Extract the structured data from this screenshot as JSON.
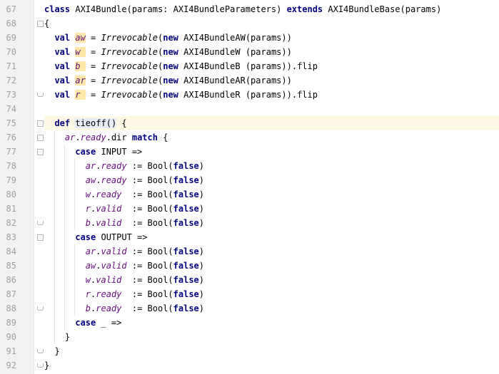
{
  "editor": {
    "lines": [
      {
        "num": "67",
        "tokens": [
          {
            "t": "class ",
            "c": "kw"
          },
          {
            "t": "AXI4Bundle(params: AXI4BundleParameters) "
          },
          {
            "t": "extends ",
            "c": "kw"
          },
          {
            "t": "AXI4BundleBase(params)"
          }
        ]
      },
      {
        "num": "68",
        "tokens": [
          {
            "t": "{"
          }
        ]
      },
      {
        "num": "69",
        "tokens": [
          {
            "t": "  "
          },
          {
            "t": "val ",
            "c": "kw"
          },
          {
            "t": "aw",
            "c": "field mark"
          },
          {
            "t": " = "
          },
          {
            "t": "Irrevocable",
            "c": "it"
          },
          {
            "t": "("
          },
          {
            "t": "new ",
            "c": "kw"
          },
          {
            "t": "AXI4BundleAW(params))"
          }
        ]
      },
      {
        "num": "70",
        "tokens": [
          {
            "t": "  "
          },
          {
            "t": "val ",
            "c": "kw"
          },
          {
            "t": "w ",
            "c": "field mark"
          },
          {
            "t": " = "
          },
          {
            "t": "Irrevocable",
            "c": "it"
          },
          {
            "t": "("
          },
          {
            "t": "new ",
            "c": "kw"
          },
          {
            "t": "AXI4BundleW (params))"
          }
        ]
      },
      {
        "num": "71",
        "tokens": [
          {
            "t": "  "
          },
          {
            "t": "val ",
            "c": "kw"
          },
          {
            "t": "b ",
            "c": "field mark"
          },
          {
            "t": " = "
          },
          {
            "t": "Irrevocable",
            "c": "it"
          },
          {
            "t": "("
          },
          {
            "t": "new ",
            "c": "kw"
          },
          {
            "t": "AXI4BundleB (params)).flip"
          }
        ]
      },
      {
        "num": "72",
        "tokens": [
          {
            "t": "  "
          },
          {
            "t": "val ",
            "c": "kw"
          },
          {
            "t": "ar",
            "c": "field mark"
          },
          {
            "t": " = "
          },
          {
            "t": "Irrevocable",
            "c": "it"
          },
          {
            "t": "("
          },
          {
            "t": "new ",
            "c": "kw"
          },
          {
            "t": "AXI4BundleAR(params))"
          }
        ]
      },
      {
        "num": "73",
        "tokens": [
          {
            "t": "  "
          },
          {
            "t": "val ",
            "c": "kw"
          },
          {
            "t": "r ",
            "c": "field mark"
          },
          {
            "t": " = "
          },
          {
            "t": "Irrevocable",
            "c": "it"
          },
          {
            "t": "("
          },
          {
            "t": "new ",
            "c": "kw"
          },
          {
            "t": "AXI4BundleR (params)).flip"
          }
        ]
      },
      {
        "num": "74",
        "tokens": []
      },
      {
        "num": "75",
        "tokens": [
          {
            "t": "  "
          },
          {
            "t": "def ",
            "c": "kw"
          },
          {
            "t": "tieoff",
            "c": "mark2"
          },
          {
            "t": "()",
            "c": "mark2"
          },
          {
            "t": " {"
          }
        ]
      },
      {
        "num": "76",
        "tokens": [
          {
            "t": "    "
          },
          {
            "t": "ar",
            "c": "field"
          },
          {
            "t": "."
          },
          {
            "t": "ready",
            "c": "field"
          },
          {
            "t": ".dir "
          },
          {
            "t": "match",
            "c": "kw"
          },
          {
            "t": " {"
          }
        ]
      },
      {
        "num": "77",
        "tokens": [
          {
            "t": "      "
          },
          {
            "t": "case ",
            "c": "kw"
          },
          {
            "t": "INPUT =>"
          }
        ]
      },
      {
        "num": "78",
        "tokens": [
          {
            "t": "        "
          },
          {
            "t": "ar",
            "c": "field"
          },
          {
            "t": "."
          },
          {
            "t": "ready",
            "c": "field"
          },
          {
            "t": " := Bool("
          },
          {
            "t": "false",
            "c": "kw"
          },
          {
            "t": ")"
          }
        ]
      },
      {
        "num": "79",
        "tokens": [
          {
            "t": "        "
          },
          {
            "t": "aw",
            "c": "field"
          },
          {
            "t": "."
          },
          {
            "t": "ready",
            "c": "field"
          },
          {
            "t": " := Bool("
          },
          {
            "t": "false",
            "c": "kw"
          },
          {
            "t": ")"
          }
        ]
      },
      {
        "num": "80",
        "tokens": [
          {
            "t": "        "
          },
          {
            "t": "w",
            "c": "field"
          },
          {
            "t": "."
          },
          {
            "t": "ready",
            "c": "field"
          },
          {
            "t": "  := Bool("
          },
          {
            "t": "false",
            "c": "kw"
          },
          {
            "t": ")"
          }
        ]
      },
      {
        "num": "81",
        "tokens": [
          {
            "t": "        "
          },
          {
            "t": "r",
            "c": "field"
          },
          {
            "t": "."
          },
          {
            "t": "valid",
            "c": "field"
          },
          {
            "t": "  := Bool("
          },
          {
            "t": "false",
            "c": "kw"
          },
          {
            "t": ")"
          }
        ]
      },
      {
        "num": "82",
        "tokens": [
          {
            "t": "        "
          },
          {
            "t": "b",
            "c": "field"
          },
          {
            "t": "."
          },
          {
            "t": "valid",
            "c": "field"
          },
          {
            "t": "  := Bool("
          },
          {
            "t": "false",
            "c": "kw"
          },
          {
            "t": ")"
          }
        ]
      },
      {
        "num": "83",
        "tokens": [
          {
            "t": "      "
          },
          {
            "t": "case ",
            "c": "kw"
          },
          {
            "t": "OUTPUT =>"
          }
        ]
      },
      {
        "num": "84",
        "tokens": [
          {
            "t": "        "
          },
          {
            "t": "ar",
            "c": "field"
          },
          {
            "t": "."
          },
          {
            "t": "valid",
            "c": "field"
          },
          {
            "t": " := Bool("
          },
          {
            "t": "false",
            "c": "kw"
          },
          {
            "t": ")"
          }
        ]
      },
      {
        "num": "85",
        "tokens": [
          {
            "t": "        "
          },
          {
            "t": "aw",
            "c": "field"
          },
          {
            "t": "."
          },
          {
            "t": "valid",
            "c": "field"
          },
          {
            "t": " := Bool("
          },
          {
            "t": "false",
            "c": "kw"
          },
          {
            "t": ")"
          }
        ]
      },
      {
        "num": "86",
        "tokens": [
          {
            "t": "        "
          },
          {
            "t": "w",
            "c": "field"
          },
          {
            "t": "."
          },
          {
            "t": "valid",
            "c": "field"
          },
          {
            "t": "  := Bool("
          },
          {
            "t": "false",
            "c": "kw"
          },
          {
            "t": ")"
          }
        ]
      },
      {
        "num": "87",
        "tokens": [
          {
            "t": "        "
          },
          {
            "t": "r",
            "c": "field"
          },
          {
            "t": "."
          },
          {
            "t": "ready",
            "c": "field"
          },
          {
            "t": "  := Bool("
          },
          {
            "t": "false",
            "c": "kw"
          },
          {
            "t": ")"
          }
        ]
      },
      {
        "num": "88",
        "tokens": [
          {
            "t": "        "
          },
          {
            "t": "b",
            "c": "field"
          },
          {
            "t": "."
          },
          {
            "t": "ready",
            "c": "field"
          },
          {
            "t": "  := Bool("
          },
          {
            "t": "false",
            "c": "kw"
          },
          {
            "t": ")"
          }
        ]
      },
      {
        "num": "89",
        "tokens": [
          {
            "t": "      "
          },
          {
            "t": "case ",
            "c": "kw"
          },
          {
            "t": "_ =>"
          }
        ]
      },
      {
        "num": "90",
        "tokens": [
          {
            "t": "    }"
          }
        ]
      },
      {
        "num": "91",
        "tokens": [
          {
            "t": "  }"
          }
        ]
      },
      {
        "num": "92",
        "tokens": [
          {
            "t": "}"
          }
        ]
      }
    ],
    "highlighted_line": "75",
    "colors": {
      "keyword": "#000080",
      "field": "#660e7a",
      "current_line": "#fcf8e3",
      "gutter": "#f2f2f2",
      "line_number": "#9e9e9e"
    }
  }
}
